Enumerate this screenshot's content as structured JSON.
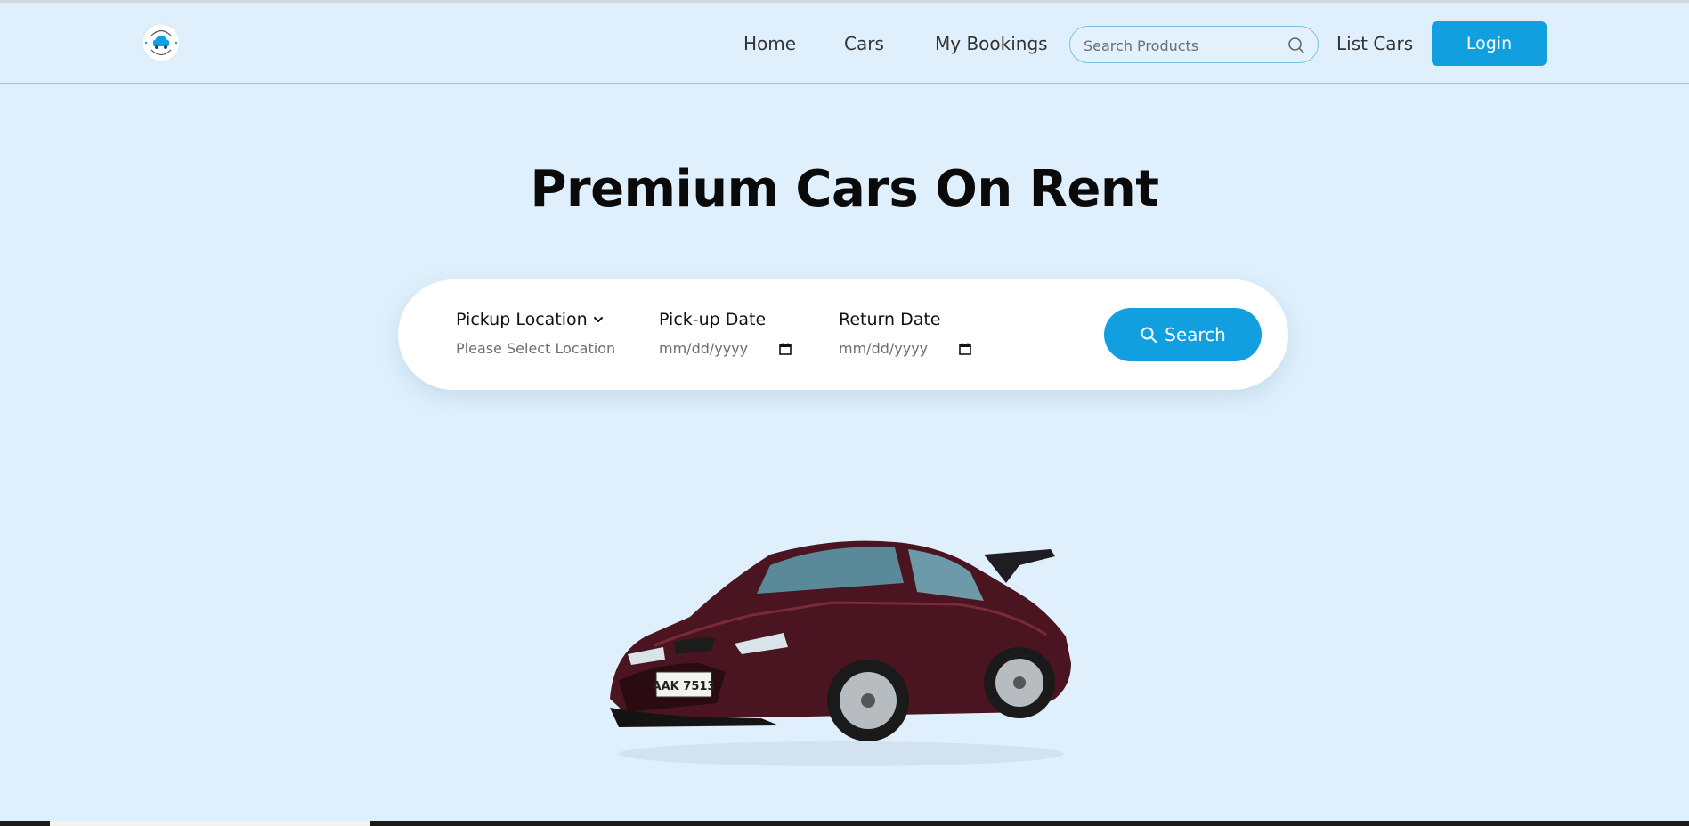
{
  "brand": {
    "logo_arc_top": "SWIFT DRIVE",
    "logo_arc_bottom": "SINCE 2025",
    "accent_color": "#119fe0"
  },
  "nav": {
    "home": "Home",
    "cars": "Cars",
    "my_bookings": "My Bookings",
    "search_placeholder": "Search Products",
    "list_cars": "List Cars",
    "login": "Login"
  },
  "hero": {
    "title": "Premium Cars On Rent"
  },
  "booking": {
    "pickup_location_label": "Pickup Location",
    "pickup_location_value": "Please Select Location",
    "pickup_date_label": "Pick-up Date",
    "pickup_date_value": "mm/dd/yyyy",
    "return_date_label": "Return Date",
    "return_date_value": "mm/dd/yyyy",
    "search_button": "Search"
  },
  "hero_image": {
    "plate_text": "AAK 7513"
  }
}
